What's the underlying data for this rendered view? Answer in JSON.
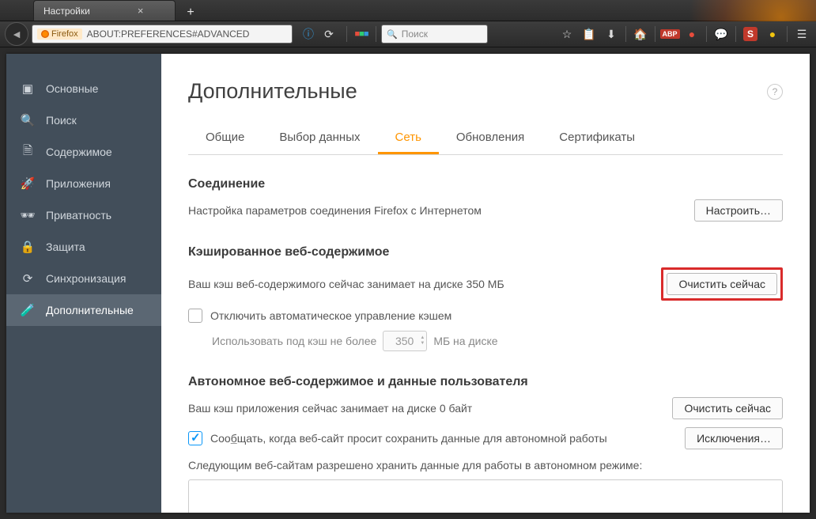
{
  "tab": {
    "title": "Настройки"
  },
  "urlbar": {
    "brand": "Firefox",
    "url": "ABOUT:PREFERENCES#ADVANCED"
  },
  "search": {
    "placeholder": "Поиск"
  },
  "sidebar": {
    "items": [
      {
        "label": "Основные",
        "icon": "▣"
      },
      {
        "label": "Поиск",
        "icon": "🔍"
      },
      {
        "label": "Содержимое",
        "icon": "🗎"
      },
      {
        "label": "Приложения",
        "icon": "🚀"
      },
      {
        "label": "Приватность",
        "icon": "🕶"
      },
      {
        "label": "Защита",
        "icon": "🔒"
      },
      {
        "label": "Синхронизация",
        "icon": "⟳"
      },
      {
        "label": "Дополнительные",
        "icon": "🧪"
      }
    ],
    "activeIndex": 7
  },
  "main": {
    "title": "Дополнительные",
    "tabs": [
      "Общие",
      "Выбор данных",
      "Сеть",
      "Обновления",
      "Сертификаты"
    ],
    "activeTab": 2,
    "connection": {
      "heading": "Соединение",
      "desc": "Настройка параметров соединения Firefox с Интернетом",
      "button": "Настроить…"
    },
    "cache": {
      "heading": "Кэшированное веб-содержимое",
      "desc": "Ваш кэш веб-содержимого сейчас занимает на диске 350 МБ",
      "button": "Очистить сейчас",
      "override": "Отключить автоматическое управление кэшем",
      "limitPre": "Использовать под кэш не более",
      "limitVal": "350",
      "limitPost": "МБ на диске"
    },
    "offline": {
      "heading": "Автономное веб-содержимое и данные пользователя",
      "desc": "Ваш кэш приложения сейчас занимает на диске 0 байт",
      "button": "Очистить сейчас",
      "notifyPre": "Соо",
      "notifyU": "б",
      "notifyPost": "щать, когда веб-сайт просит сохранить данные для автономной работы",
      "exceptions": "Исключения…",
      "allowed": "Следующим веб-сайтам разрешено хранить данные для работы в автономном режиме:"
    }
  }
}
